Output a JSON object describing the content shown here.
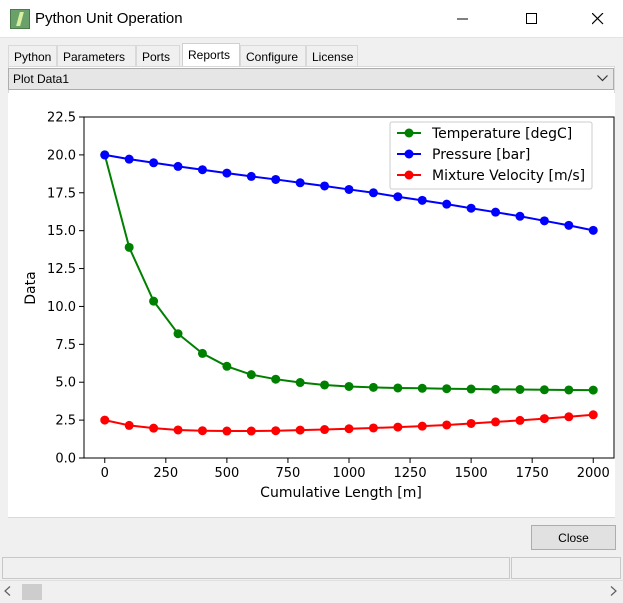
{
  "window": {
    "title": "Python Unit Operation"
  },
  "tabs": [
    {
      "label": "Python"
    },
    {
      "label": "Parameters"
    },
    {
      "label": "Ports"
    },
    {
      "label": "Reports"
    },
    {
      "label": "Configure"
    },
    {
      "label": "License"
    }
  ],
  "active_tab": "Reports",
  "dropdown": {
    "selected": "Plot Data1"
  },
  "buttons": {
    "close_label": "Close"
  },
  "chart_data": {
    "type": "line",
    "xlabel": "Cumulative Length [m]",
    "ylabel": "Data",
    "xlim": [
      -85,
      2085
    ],
    "ylim": [
      0,
      22.5
    ],
    "x_ticks": [
      "0",
      "250",
      "500",
      "750",
      "1000",
      "1250",
      "1500",
      "1750",
      "2000"
    ],
    "y_ticks": [
      "0.0",
      "2.5",
      "5.0",
      "7.5",
      "10.0",
      "12.5",
      "15.0",
      "17.5",
      "20.0",
      "22.5"
    ],
    "grid": false,
    "legend_position": "top-right",
    "x": [
      0,
      100,
      200,
      300,
      400,
      500,
      600,
      700,
      800,
      900,
      1000,
      1100,
      1200,
      1300,
      1400,
      1500,
      1600,
      1700,
      1800,
      1900,
      2000
    ],
    "series": [
      {
        "name": "Temperature [degC]",
        "color": "#008000",
        "values": [
          20.0,
          13.9,
          10.35,
          8.2,
          6.9,
          6.05,
          5.5,
          5.2,
          4.98,
          4.82,
          4.72,
          4.66,
          4.62,
          4.6,
          4.57,
          4.55,
          4.53,
          4.52,
          4.5,
          4.49,
          4.48
        ]
      },
      {
        "name": "Pressure [bar]",
        "color": "#0000ff",
        "values": [
          20.0,
          19.72,
          19.48,
          19.24,
          19.02,
          18.8,
          18.58,
          18.38,
          18.16,
          17.95,
          17.72,
          17.5,
          17.24,
          17.0,
          16.75,
          16.48,
          16.22,
          15.95,
          15.65,
          15.35,
          15.02
        ]
      },
      {
        "name": "Mixture Velocity [m/s]",
        "color": "#ff0000",
        "values": [
          2.5,
          2.15,
          1.97,
          1.85,
          1.8,
          1.78,
          1.78,
          1.8,
          1.84,
          1.88,
          1.93,
          1.98,
          2.04,
          2.1,
          2.18,
          2.28,
          2.38,
          2.48,
          2.6,
          2.72,
          2.85
        ]
      }
    ]
  }
}
